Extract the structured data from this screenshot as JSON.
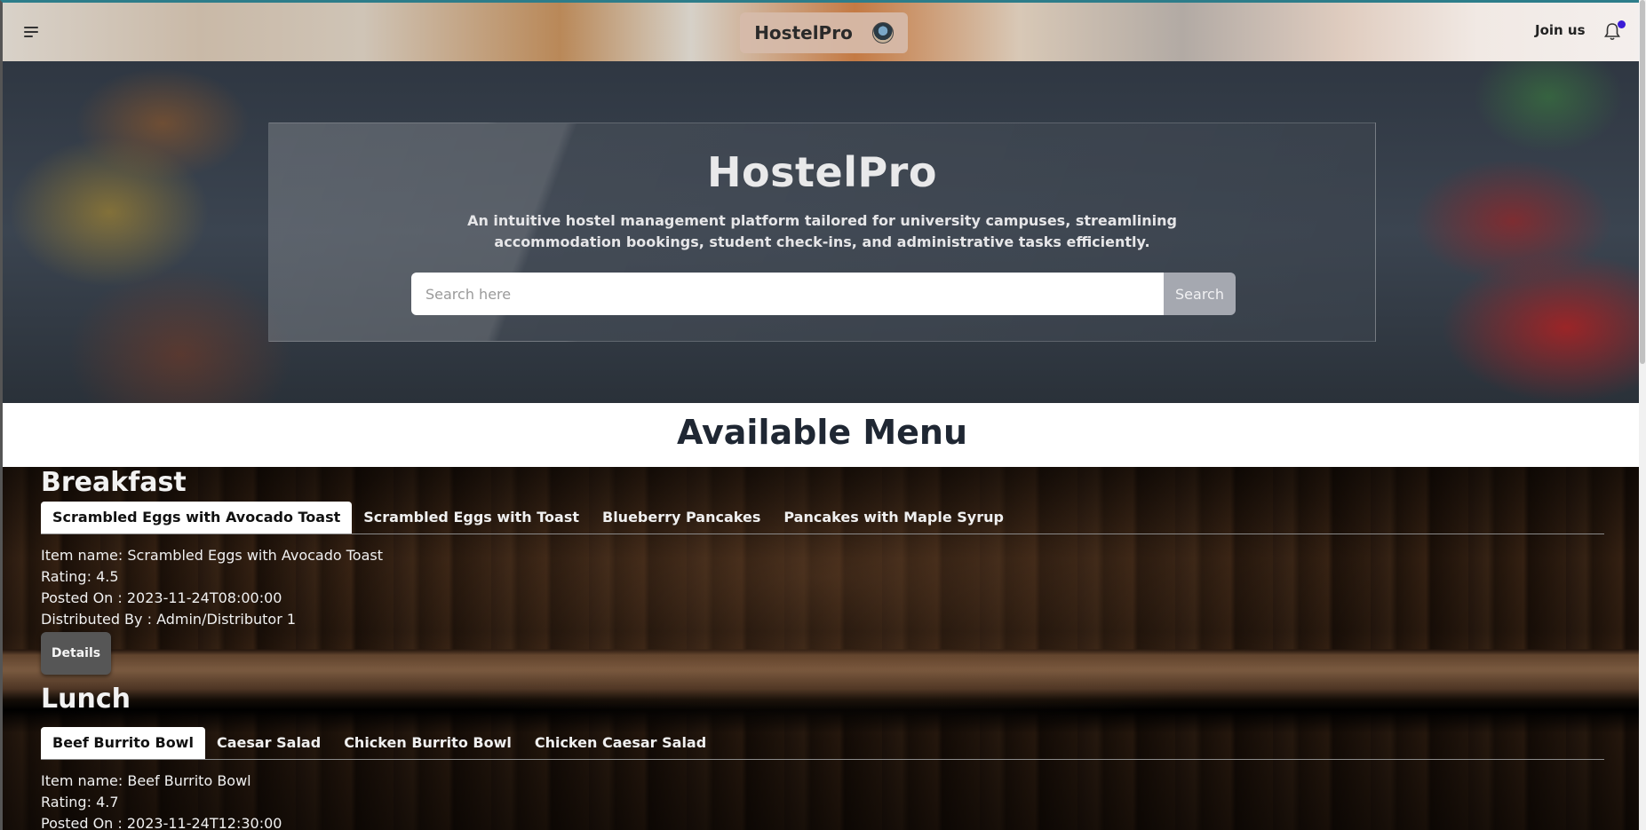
{
  "nav": {
    "brand": "HostelPro",
    "join_label": "Join us"
  },
  "hero": {
    "title": "HostelPro",
    "subtitle": "An intuitive hostel management platform tailored for university campuses, streamlining accommodation bookings, student check-ins, and administrative tasks efficiently.",
    "search_placeholder": "Search here",
    "search_button": "Search"
  },
  "menu": {
    "heading": "Available Menu",
    "meals": [
      {
        "name": "Breakfast",
        "tabs": [
          "Scrambled Eggs with Avocado Toast",
          "Scrambled Eggs with Toast",
          "Blueberry Pancakes",
          "Pancakes with Maple Syrup"
        ],
        "active_tab": 0,
        "item_name": "Item name: Scrambled Eggs with Avocado Toast",
        "rating": "Rating: 4.5",
        "posted_on": "Posted On : 2023-11-24T08:00:00",
        "distributed_by": "Distributed By : Admin/Distributor 1",
        "details_label": "Details"
      },
      {
        "name": "Lunch",
        "tabs": [
          "Beef Burrito Bowl",
          "Caesar Salad",
          "Chicken Burrito Bowl",
          "Chicken Caesar Salad"
        ],
        "active_tab": 0,
        "item_name": "Item name: Beef Burrito Bowl",
        "rating": "Rating: 4.7",
        "posted_on": "Posted On : 2023-11-24T12:30:00"
      }
    ]
  }
}
